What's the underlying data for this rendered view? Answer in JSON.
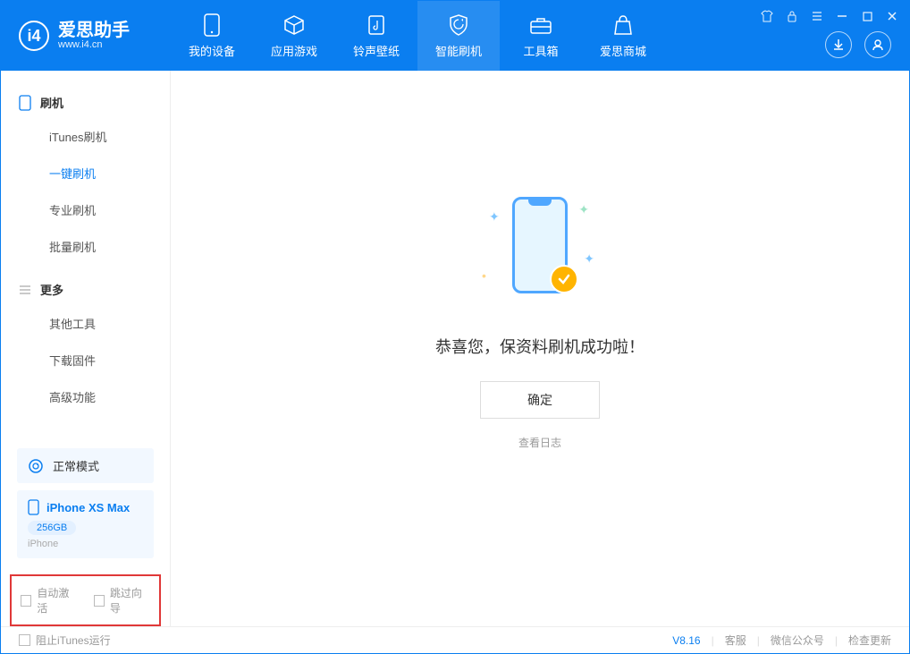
{
  "app": {
    "name": "爱思助手",
    "url": "www.i4.cn"
  },
  "tabs": {
    "device": "我的设备",
    "apps": "应用游戏",
    "ring": "铃声壁纸",
    "flash": "智能刷机",
    "tools": "工具箱",
    "store": "爱思商城"
  },
  "sidebar": {
    "flash_section": "刷机",
    "items": {
      "itunes": "iTunes刷机",
      "oneclick": "一键刷机",
      "pro": "专业刷机",
      "batch": "批量刷机"
    },
    "more_section": "更多",
    "more": {
      "other": "其他工具",
      "firmware": "下载固件",
      "advanced": "高级功能"
    }
  },
  "device": {
    "mode": "正常模式",
    "name": "iPhone XS Max",
    "storage": "256GB",
    "type": "iPhone"
  },
  "checks": {
    "auto_activate": "自动激活",
    "skip_guide": "跳过向导"
  },
  "main": {
    "success": "恭喜您，保资料刷机成功啦！",
    "ok": "确定",
    "log": "查看日志"
  },
  "footer": {
    "block_itunes": "阻止iTunes运行",
    "version": "V8.16",
    "service": "客服",
    "wechat": "微信公众号",
    "update": "检查更新"
  }
}
